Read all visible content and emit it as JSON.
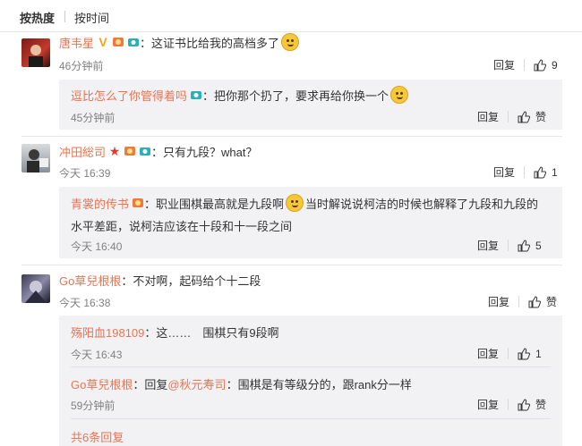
{
  "tabs": {
    "hot": "按热度",
    "time": "按时间"
  },
  "comments": [
    {
      "name": "唐韦星",
      "text": "：这证书比给我的高档多了",
      "time": "46分钟前",
      "reply": "回复",
      "likes": "9",
      "replies": [
        {
          "name": "逗比怎么了你管得着吗",
          "text": "：把你那个扔了，要求再给你换一个",
          "time": "45分钟前",
          "reply": "回复",
          "likes": "赞"
        }
      ]
    },
    {
      "name": "冲田総司",
      "text": "：只有九段？what？",
      "time": "今天 16:39",
      "reply": "回复",
      "likes": "1",
      "replies": [
        {
          "name": "青裳的传书",
          "text": "：职业围棋最高就是九段啊",
          "text2": "当时解说说柯洁的时候也解释了九段和九段的",
          "text3": "水平差距，说柯洁应该在十段和十一段之间",
          "time": "今天 16:40",
          "reply": "回复",
          "likes": "5"
        }
      ]
    },
    {
      "name": "Go草兒根根",
      "text": "：不对啊，起码给个十二段",
      "time": "今天 16:38",
      "reply": "回复",
      "likes": "赞",
      "replies": [
        {
          "name": "殇阳血198109",
          "text": "：这……　围棋只有9段啊",
          "time": "今天 16:43",
          "reply": "回复",
          "likes": "1"
        },
        {
          "name": "Go草兒根根",
          "text": "：回复",
          "mention": "@秋元寿司",
          "text_after": "：围棋是有等级分的，跟rank分一样",
          "time": "59分钟前",
          "reply": "回复",
          "likes": "赞"
        }
      ],
      "more": "共6条回复"
    }
  ]
}
